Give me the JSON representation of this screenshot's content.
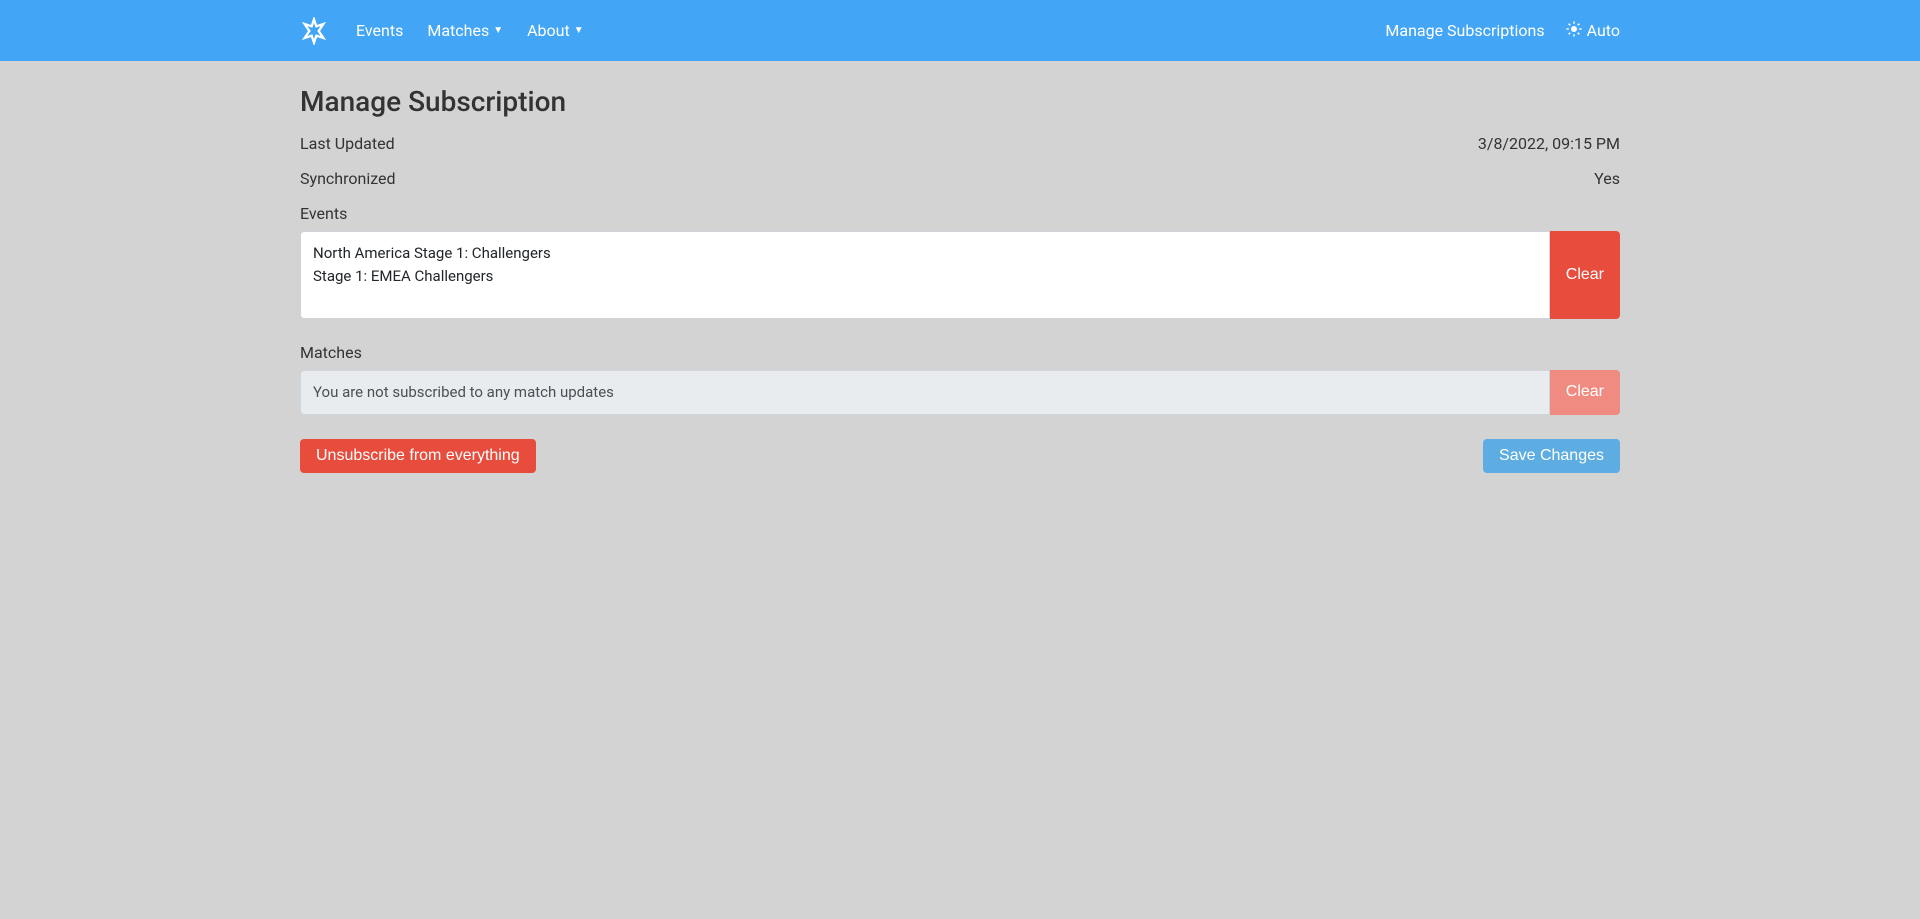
{
  "navbar": {
    "events_label": "Events",
    "matches_label": "Matches",
    "about_label": "About",
    "manage_subscriptions_label": "Manage Subscriptions",
    "theme_label": "Auto"
  },
  "page": {
    "title": "Manage Subscription",
    "last_updated_label": "Last Updated",
    "last_updated_value": "3/8/2022, 09:15 PM",
    "synchronized_label": "Synchronized",
    "synchronized_value": "Yes",
    "events_section_label": "Events",
    "events_list": [
      "North America Stage 1: Challengers",
      "Stage 1: EMEA Challengers"
    ],
    "events_clear_label": "Clear",
    "matches_section_label": "Matches",
    "matches_empty_text": "You are not subscribed to any match updates",
    "matches_clear_label": "Clear",
    "unsubscribe_label": "Unsubscribe from everything",
    "save_label": "Save Changes"
  }
}
